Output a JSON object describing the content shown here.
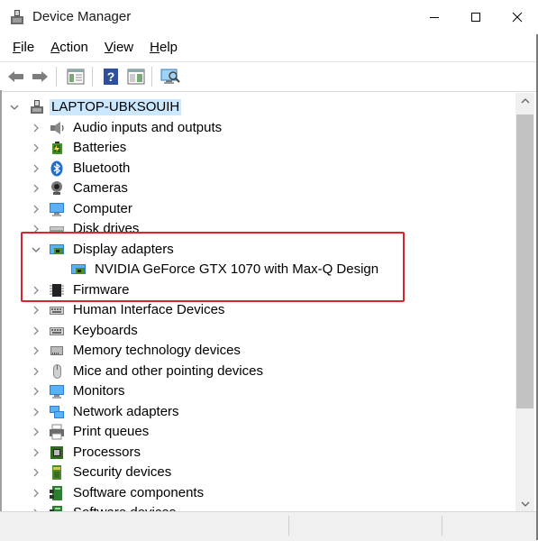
{
  "window": {
    "title": "Device Manager",
    "controls": [
      "minimize",
      "maximize",
      "close"
    ]
  },
  "menu": {
    "items": [
      {
        "label": "File",
        "access": "F",
        "rest": "ile"
      },
      {
        "label": "Action",
        "access": "A",
        "rest": "ction"
      },
      {
        "label": "View",
        "access": "V",
        "rest": "iew"
      },
      {
        "label": "Help",
        "access": "H",
        "rest": "elp"
      }
    ]
  },
  "toolbar": {
    "icons": [
      "back-arrow-icon",
      "forward-arrow-icon",
      "properties-icon",
      "help-icon",
      "show-hide-pane-icon",
      "scan-hardware-icon"
    ]
  },
  "tree": {
    "root": {
      "label": "LAPTOP-UBKSOUIH",
      "icon": "computer-icon"
    },
    "items": [
      {
        "label": "Audio inputs and outputs",
        "icon": "speaker-icon",
        "expanded": false
      },
      {
        "label": "Batteries",
        "icon": "battery-icon",
        "expanded": false
      },
      {
        "label": "Bluetooth",
        "icon": "bluetooth-icon",
        "expanded": false
      },
      {
        "label": "Cameras",
        "icon": "camera-icon",
        "expanded": false
      },
      {
        "label": "Computer",
        "icon": "monitor-icon",
        "expanded": false
      },
      {
        "label": "Disk drives",
        "icon": "disk-drive-icon",
        "expanded": false
      },
      {
        "label": "Display adapters",
        "icon": "display-adapter-icon",
        "expanded": true
      },
      {
        "label": "NVIDIA GeForce GTX 1070 with Max-Q Design",
        "icon": "display-adapter-icon",
        "child": true
      },
      {
        "label": "Firmware",
        "icon": "firmware-chip-icon",
        "expanded": false
      },
      {
        "label": "Human Interface Devices",
        "icon": "keyboard-icon",
        "expanded": false
      },
      {
        "label": "Keyboards",
        "icon": "keyboard-icon",
        "expanded": false
      },
      {
        "label": "Memory technology devices",
        "icon": "memory-card-icon",
        "expanded": false
      },
      {
        "label": "Mice and other pointing devices",
        "icon": "mouse-icon",
        "expanded": false
      },
      {
        "label": "Monitors",
        "icon": "monitor-icon",
        "expanded": false
      },
      {
        "label": "Network adapters",
        "icon": "network-icon",
        "expanded": false
      },
      {
        "label": "Print queues",
        "icon": "printer-icon",
        "expanded": false
      },
      {
        "label": "Processors",
        "icon": "processor-icon",
        "expanded": false
      },
      {
        "label": "Security devices",
        "icon": "security-device-icon",
        "expanded": false
      },
      {
        "label": "Software components",
        "icon": "software-component-icon",
        "expanded": false
      },
      {
        "label": "Software devices",
        "icon": "software-device-icon",
        "expanded": false
      }
    ]
  },
  "colors": {
    "highlight_border": "#d9262e",
    "selection": "#cce8ff"
  }
}
